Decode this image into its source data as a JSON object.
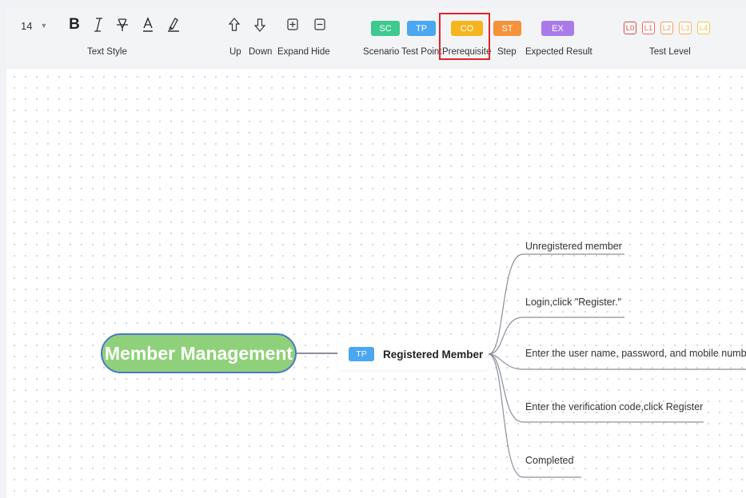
{
  "toolbar": {
    "font_size": "14",
    "text_style": {
      "label": "Text Style",
      "bold": "B",
      "italic": "I",
      "strikethrough": "̶A",
      "font_color": "A",
      "highlight": "✎"
    },
    "node_ops": {
      "up_label": "Up",
      "down_label": "Down",
      "expand_label": "Expand",
      "hide_label": "Hide"
    },
    "tags": [
      {
        "code": "SC",
        "label": "Scenario",
        "color": "#3fc88f"
      },
      {
        "code": "TP",
        "label": "Test Point",
        "color": "#4aa7f0"
      },
      {
        "code": "CO",
        "label": "Prerequisite",
        "color": "#f6b51e"
      },
      {
        "code": "ST",
        "label": "Step",
        "color": "#f5923a"
      },
      {
        "code": "EX",
        "label": "Expected Result",
        "color": "#a97bea"
      }
    ],
    "test_level": {
      "label": "Test Level",
      "levels": [
        {
          "code": "L0",
          "color": "#d6463e"
        },
        {
          "code": "L1",
          "color": "#e8695f"
        },
        {
          "code": "L2",
          "color": "#f19b5e"
        },
        {
          "code": "L3",
          "color": "#f4b06c"
        },
        {
          "code": "L4",
          "color": "#f2c74d"
        }
      ]
    }
  },
  "mindmap": {
    "root": "Member Management",
    "child": {
      "tag": "TP",
      "label": "Registered Member"
    },
    "leaves": [
      "Unregistered member",
      "Login,click \"Register.\"",
      "Enter the user name, password, and mobile number.",
      "Enter the verification code,click Register",
      "Completed"
    ]
  }
}
